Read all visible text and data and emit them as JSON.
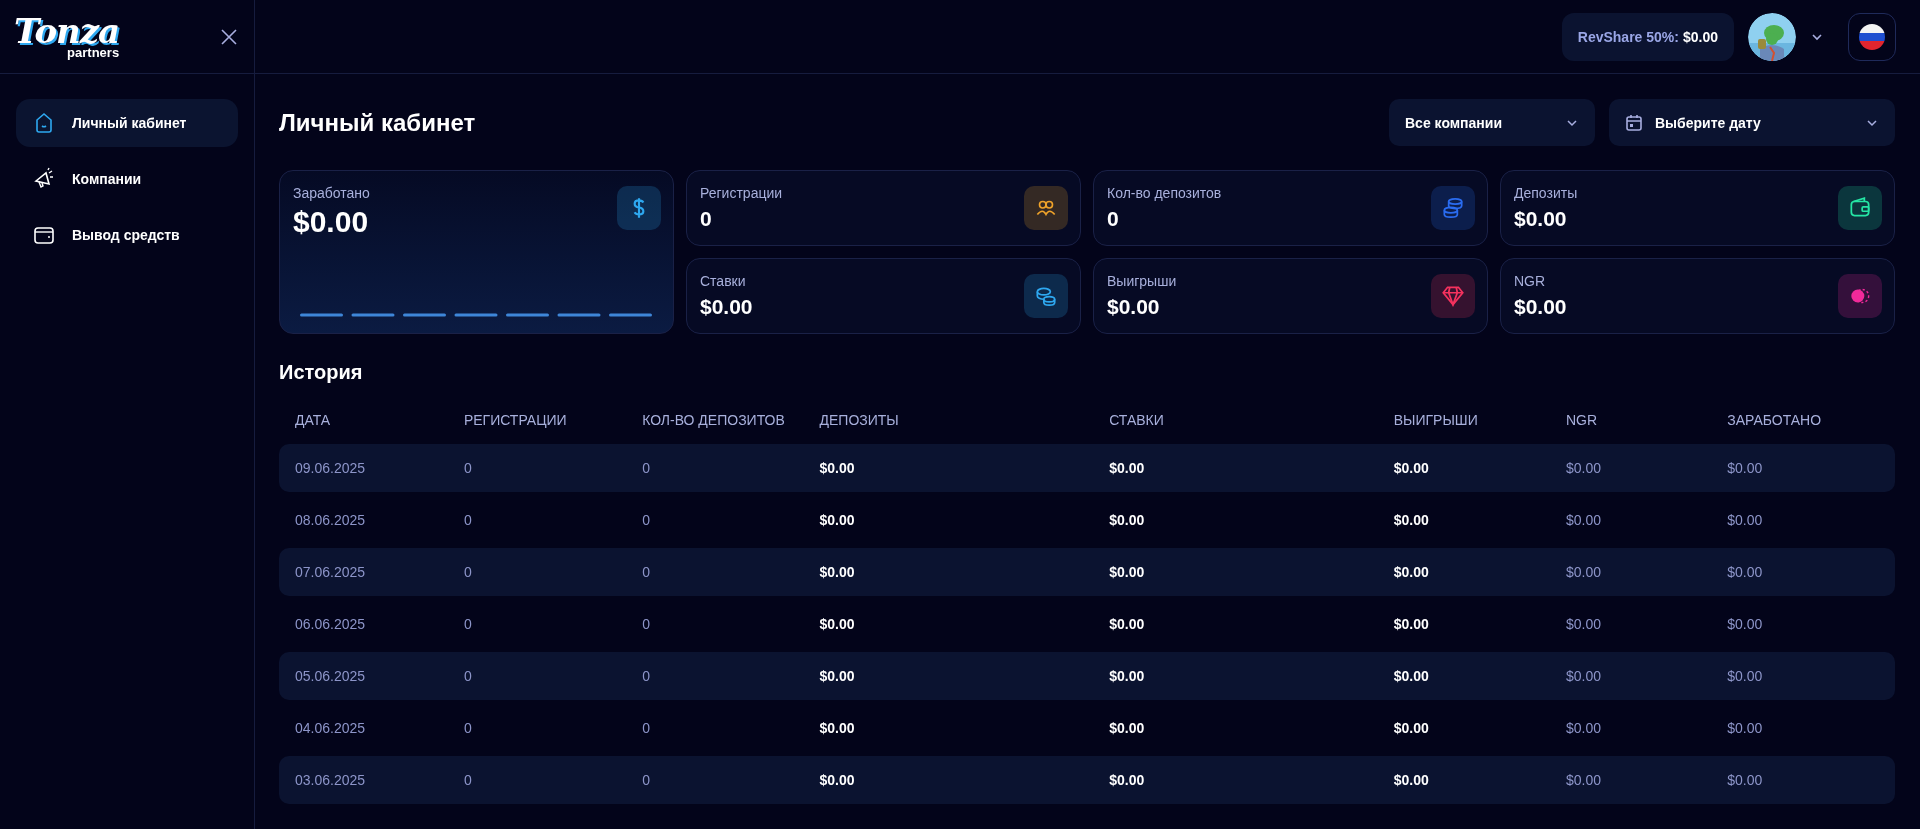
{
  "logo": {
    "name": "Tonza",
    "sub": "partners"
  },
  "sidebar": {
    "items": [
      {
        "label": "Личный кабинет",
        "selected": true
      },
      {
        "label": "Компании",
        "selected": false
      },
      {
        "label": "Вывод средств",
        "selected": false
      }
    ]
  },
  "header": {
    "revshare": {
      "label": "RevShare 50%:",
      "value": "$0.00"
    }
  },
  "page": {
    "title": "Личный кабинет",
    "filters": [
      {
        "label": "Все компании",
        "kind": "select"
      },
      {
        "label": "Выберите дату",
        "kind": "date"
      }
    ]
  },
  "stats": {
    "main": {
      "label": "Заработано",
      "value": "$0.00",
      "color": "#2ea8f0"
    },
    "cards": [
      {
        "label": "Регистрации",
        "value": "0",
        "color": "#f0a32a"
      },
      {
        "label": "Кол-во депозитов",
        "value": "0",
        "color": "#2a6cf0"
      },
      {
        "label": "Депозиты",
        "value": "$0.00",
        "color": "#25e6a5"
      },
      {
        "label": "Ставки",
        "value": "$0.00",
        "color": "#2ea8f0"
      },
      {
        "label": "Выигрыши",
        "value": "$0.00",
        "color": "#f5325e"
      },
      {
        "label": "NGR",
        "value": "$0.00",
        "color": "#f02a9a"
      }
    ]
  },
  "history": {
    "title": "История",
    "columns": [
      {
        "label": "ДАТА",
        "kind": "muted"
      },
      {
        "label": "РЕГИСТРАЦИИ",
        "kind": "muted"
      },
      {
        "label": "КОЛ-ВО ДЕПОЗИТОВ",
        "kind": "muted"
      },
      {
        "label": "ДЕПОЗИТЫ",
        "kind": "strong"
      },
      {
        "label": "СТАВКИ",
        "kind": "strong"
      },
      {
        "label": "ВЫИГРЫШИ",
        "kind": "strong"
      },
      {
        "label": "NGR",
        "kind": "muted"
      },
      {
        "label": "ЗАРАБОТАНО",
        "kind": "muted"
      }
    ],
    "rows": [
      [
        "09.06.2025",
        "0",
        "0",
        "$0.00",
        "$0.00",
        "$0.00",
        "$0.00",
        "$0.00"
      ],
      [
        "08.06.2025",
        "0",
        "0",
        "$0.00",
        "$0.00",
        "$0.00",
        "$0.00",
        "$0.00"
      ],
      [
        "07.06.2025",
        "0",
        "0",
        "$0.00",
        "$0.00",
        "$0.00",
        "$0.00",
        "$0.00"
      ],
      [
        "06.06.2025",
        "0",
        "0",
        "$0.00",
        "$0.00",
        "$0.00",
        "$0.00",
        "$0.00"
      ],
      [
        "05.06.2025",
        "0",
        "0",
        "$0.00",
        "$0.00",
        "$0.00",
        "$0.00",
        "$0.00"
      ],
      [
        "04.06.2025",
        "0",
        "0",
        "$0.00",
        "$0.00",
        "$0.00",
        "$0.00",
        "$0.00"
      ],
      [
        "03.06.2025",
        "0",
        "0",
        "$0.00",
        "$0.00",
        "$0.00",
        "$0.00",
        "$0.00"
      ]
    ]
  }
}
